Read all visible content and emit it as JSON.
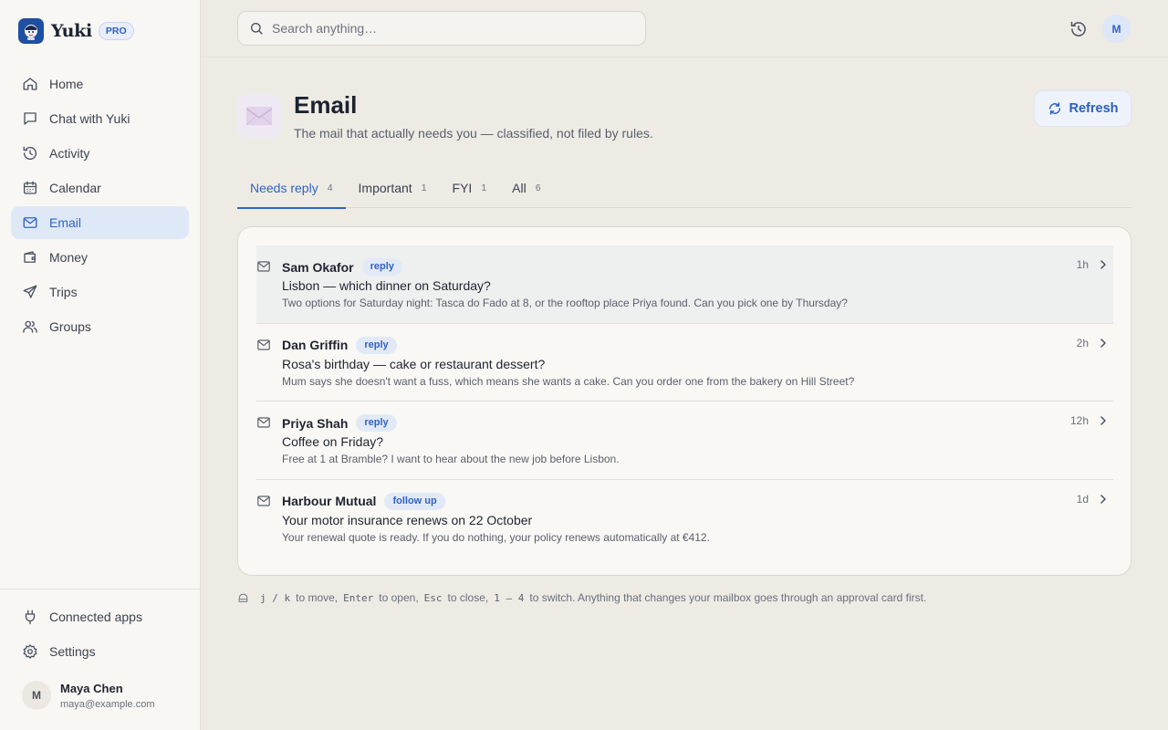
{
  "app": {
    "name": "Yuki",
    "badge": "PRO"
  },
  "sidebar": {
    "items": [
      {
        "label": "Home",
        "icon": "home-icon"
      },
      {
        "label": "Chat with Yuki",
        "icon": "chat-icon"
      },
      {
        "label": "Activity",
        "icon": "history-icon"
      },
      {
        "label": "Calendar",
        "icon": "calendar-icon"
      },
      {
        "label": "Email",
        "icon": "mail-icon",
        "active": true
      },
      {
        "label": "Money",
        "icon": "wallet-icon"
      },
      {
        "label": "Trips",
        "icon": "plane-icon"
      },
      {
        "label": "Groups",
        "icon": "users-icon"
      }
    ],
    "bottom": [
      {
        "label": "Connected apps",
        "icon": "plug-icon"
      },
      {
        "label": "Settings",
        "icon": "gear-icon"
      }
    ],
    "user": {
      "initial": "M",
      "name": "Maya Chen",
      "email": "maya@example.com"
    }
  },
  "topbar": {
    "search_placeholder": "Search anything…",
    "avatar_initial": "M"
  },
  "page": {
    "title": "Email",
    "subtitle": "The mail that actually needs you — classified, not filed by rules.",
    "refresh_label": "Refresh"
  },
  "tabs": [
    {
      "label": "Needs reply",
      "count": "4",
      "active": true
    },
    {
      "label": "Important",
      "count": "1"
    },
    {
      "label": "FYI",
      "count": "1"
    },
    {
      "label": "All",
      "count": "6"
    }
  ],
  "emails": [
    {
      "sender": "Sam Okafor",
      "tag": "reply",
      "subject": "Lisbon — which dinner on Saturday?",
      "preview": "Two options for Saturday night: Tasca do Fado at 8, or the rooftop place Priya found. Can you pick one by Thursday?",
      "time": "1h"
    },
    {
      "sender": "Dan Griffin",
      "tag": "reply",
      "subject": "Rosa's birthday — cake or restaurant dessert?",
      "preview": "Mum says she doesn't want a fuss, which means she wants a cake. Can you order one from the bakery on Hill Street?",
      "time": "2h"
    },
    {
      "sender": "Priya Shah",
      "tag": "reply",
      "subject": "Coffee on Friday?",
      "preview": "Free at 1 at Bramble? I want to hear about the new job before Lisbon.",
      "time": "12h"
    },
    {
      "sender": "Harbour Mutual",
      "tag": "follow up",
      "subject": "Your motor insurance renews on 22 October",
      "preview": "Your renewal quote is ready. If you do nothing, your policy renews automatically at €412.",
      "time": "1d"
    }
  ],
  "hint": {
    "k1": "j / k",
    "t1": "to move,",
    "k2": "Enter",
    "t2": "to open,",
    "k3": "Esc",
    "t3": "to close,",
    "k4": "1 – 4",
    "t4": "to switch. Anything that changes your mailbox goes through an approval card first."
  },
  "colors": {
    "accent": "#2f64c4",
    "background": "#eeebe5",
    "sidebar": "#f8f7f4"
  }
}
